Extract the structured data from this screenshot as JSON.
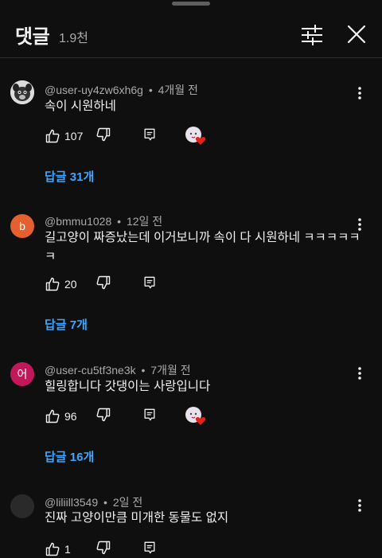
{
  "header": {
    "title": "댓글",
    "count": "1.9천"
  },
  "comments": [
    {
      "author": "@user-uy4zw6xh6g",
      "time": "4개월 전",
      "text": "속이 시원하네",
      "likes": "107",
      "creator_heart": true,
      "replies_label": "답글 31개",
      "avatar_letter": "",
      "avatar_color": "#e8e8e8"
    },
    {
      "author": "@bmmu1028",
      "time": "12일 전",
      "text": "길고양이 짜증났는데 이거보니까 속이 다 시원하네 ㅋㅋㅋㅋㅋㅋ",
      "likes": "20",
      "creator_heart": false,
      "replies_label": "답글 7개",
      "avatar_letter": "b",
      "avatar_color": "#e5602f"
    },
    {
      "author": "@user-cu5tf3ne3k",
      "time": "7개월 전",
      "text": "힐링합니다 갓댕이는 사랑입니다",
      "likes": "96",
      "creator_heart": true,
      "replies_label": "답글 16개",
      "avatar_letter": "어",
      "avatar_color": "#c2185b"
    },
    {
      "author": "@liliill3549",
      "time": "2일 전",
      "text": "진짜 고양이만큼 미개한 동물도 없지",
      "likes": "1",
      "creator_heart": false,
      "replies_label": "",
      "avatar_letter": "",
      "avatar_color": "#2a2a2a"
    }
  ],
  "separator": "•"
}
